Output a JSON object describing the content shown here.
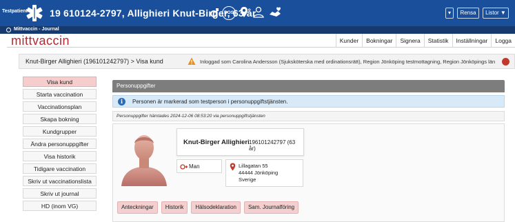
{
  "topbar": {
    "testpatient_label": "Testpatient",
    "patient_title": "19 610124-2797,  Allighieri Knut-Birger,  63 år",
    "dos_label": "DOS",
    "rensa_label": "Rensa",
    "listor_label": "Listor ▼",
    "dropdown_label": "▾"
  },
  "app_tab": {
    "title": "Mittvaccin - Journal"
  },
  "nav": {
    "logo": "mittvaccin",
    "items": [
      "Kunder",
      "Bokningar",
      "Signera",
      "Statistik",
      "Inställningar",
      "Logga"
    ]
  },
  "crumbbar": {
    "breadcrumb": "Knut-Birger Allighieri (196101242797) > Visa kund",
    "login_text": "Inloggad som Carolina Andersson (Sjuksköterska med ordinationsrätt), Region Jönköping testmottagning, Region Jönköpings län"
  },
  "sidebar": {
    "items": [
      "Visa kund",
      "Starta vaccination",
      "Vaccinationsplan",
      "Skapa bokning",
      "Kundgrupper",
      "Ändra personuppgifter",
      "Visa historik",
      "Tidigare vaccination",
      "Skriv ut vaccinationslista",
      "Skriv ut journal",
      "HD (inom VG)"
    ]
  },
  "panel": {
    "title": "Personuppgifter",
    "info_text": "Personen är markerad som testperson i personuppgiftstjänsten.",
    "fetched_text": "Personuppgifter hämtades 2024-12-06 08:53:20 via personuppgiftstjänsten"
  },
  "person": {
    "name": "Knut-Birger Allighieri",
    "personnummer": "196101242797 (63 år)",
    "gender": "Man",
    "address_street": "Lillagatan 55",
    "address_city": "44444 Jönköping",
    "address_country": "Sverige"
  },
  "tabs": [
    "Anteckningar",
    "Historik",
    "Hälsodeklaration",
    "Sam. Journalföring"
  ],
  "colors": {
    "topbar": "#1a4f9c",
    "logo": "#b12a32",
    "active_side": "#f5cdcd",
    "info_bg": "#d8eaf7"
  }
}
